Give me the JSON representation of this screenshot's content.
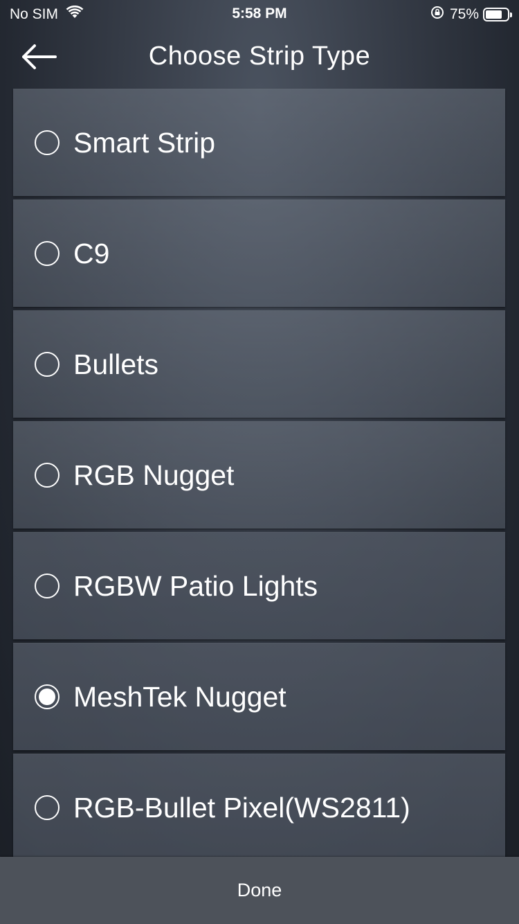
{
  "status_bar": {
    "carrier": "No SIM",
    "time": "5:58 PM",
    "battery_percent": "75%",
    "battery_level": 0.75,
    "icons": [
      "wifi-icon",
      "orientation-lock-icon",
      "battery-icon"
    ]
  },
  "header": {
    "title": "Choose Strip Type",
    "back_icon": "back-arrow-icon"
  },
  "strip_types": [
    {
      "label": "Smart Strip",
      "selected": false
    },
    {
      "label": "C9",
      "selected": false
    },
    {
      "label": "Bullets",
      "selected": false
    },
    {
      "label": "RGB Nugget",
      "selected": false
    },
    {
      "label": "RGBW Patio Lights",
      "selected": false
    },
    {
      "label": "MeshTek Nugget",
      "selected": true
    },
    {
      "label": "RGB-Bullet Pixel(WS2811)",
      "selected": false
    }
  ],
  "footer": {
    "done_label": "Done"
  },
  "colors": {
    "background": "#2a2f38",
    "text": "#ffffff",
    "done_bar": "#4d525a"
  }
}
